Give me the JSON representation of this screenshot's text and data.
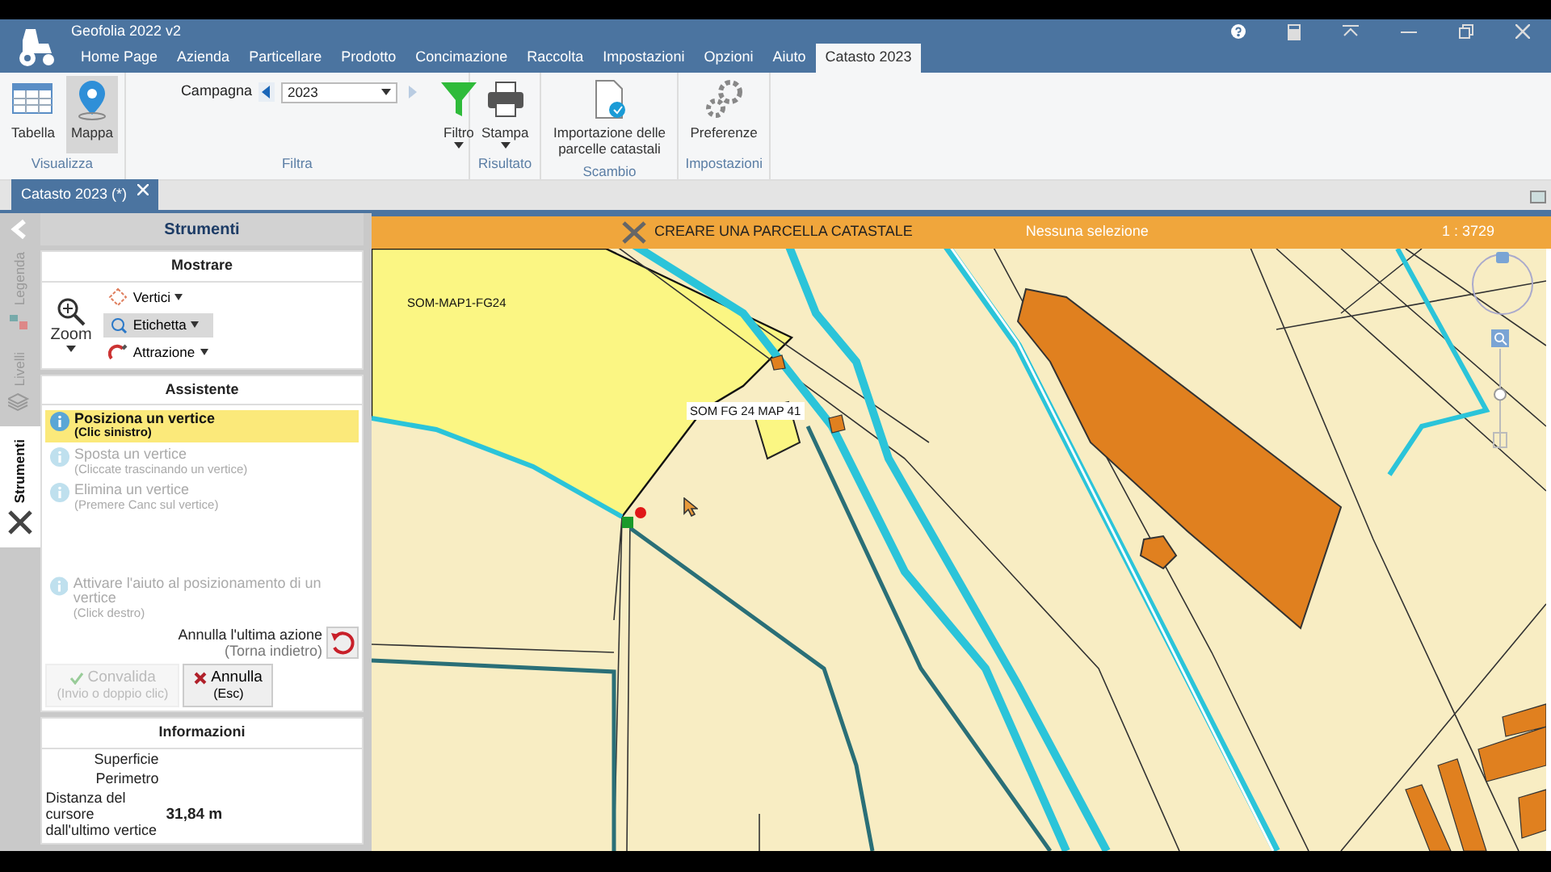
{
  "app": {
    "title": "Geofolia 2022 v2"
  },
  "menu": [
    {
      "label": "Home Page",
      "selected": false
    },
    {
      "label": "Azienda",
      "selected": false
    },
    {
      "label": "Particellare",
      "selected": false
    },
    {
      "label": "Prodotto",
      "selected": false
    },
    {
      "label": "Concimazione",
      "selected": false
    },
    {
      "label": "Raccolta",
      "selected": false
    },
    {
      "label": "Impostazioni",
      "selected": false
    },
    {
      "label": "Opzioni",
      "selected": false
    },
    {
      "label": "Aiuto",
      "selected": false
    },
    {
      "label": "Catasto 2023",
      "selected": true
    }
  ],
  "ribbon": [
    {
      "label": "Visualizza",
      "items": [
        {
          "kind": "toggle",
          "label": "Tabella",
          "selected": false
        },
        {
          "kind": "toggle",
          "label": "Mappa",
          "selected": true
        }
      ]
    },
    {
      "label": "Filtra",
      "items": [
        {
          "kind": "campagna",
          "label": "Campagna",
          "value": "2023"
        },
        {
          "kind": "dropdown",
          "label": "Filtro"
        }
      ]
    },
    {
      "label": "Risultato",
      "items": [
        {
          "kind": "dropdown",
          "label": "Stampa"
        }
      ]
    },
    {
      "label": "Scambio",
      "items": [
        {
          "kind": "menu",
          "label": "Importazione delle parcelle catastali"
        }
      ]
    },
    {
      "label": "Impostazioni",
      "items": [
        {
          "kind": "plain",
          "label": "Preferenze"
        }
      ]
    }
  ],
  "doc_tab": {
    "label": "Catasto 2023 (*)"
  },
  "side_tabs": [
    {
      "label": "Legenda",
      "selected": false
    },
    {
      "label": "Livelli",
      "selected": false
    },
    {
      "label": "Strumenti",
      "selected": true
    }
  ],
  "panel": {
    "title": "Strumenti",
    "mostrare": {
      "title": "Mostrare",
      "zoom": "Zoom",
      "tools": [
        {
          "label": "Vertici",
          "selected": false
        },
        {
          "label": "Etichetta",
          "selected": true
        },
        {
          "label": "Attrazione",
          "selected": false
        }
      ]
    },
    "assistente": {
      "title": "Assistente",
      "steps": [
        {
          "title": "Posiziona un vertice",
          "hint": "(Clic sinistro)",
          "selected": true
        },
        {
          "title": "Sposta un vertice",
          "hint": "(Cliccate trascinando un vertice)",
          "selected": false
        },
        {
          "title": "Elimina un vertice",
          "hint": "(Premere Canc sul vertice)",
          "selected": false
        }
      ],
      "help": {
        "title": "Attivare l'aiuto al posizionamento di un vertice",
        "hint": "(Click destro)",
        "selected": false
      },
      "undo": {
        "label": "Annulla l'ultima azione",
        "hint": "(Torna indietro)"
      },
      "buttons": [
        {
          "kind": "confirm",
          "label": "Convalida",
          "hint": "(Invio o doppio clic)",
          "disabled": true
        },
        {
          "kind": "cancel",
          "label": "Annulla",
          "hint": "(Esc)",
          "disabled": false
        }
      ]
    },
    "informazioni": {
      "title": "Informazioni",
      "rows": [
        {
          "label": "Superficie"
        },
        {
          "label": "Perimetro"
        },
        {
          "label": "Distanza del cursore dall'ultimo vertice",
          "value": "31,84 m"
        }
      ]
    }
  },
  "map": {
    "tool": "CREARE UNA PARCELLA CATASTALE",
    "selection": "Nessuna selezione",
    "scale": "1 : 3729",
    "zoom": {
      "level": 0.55
    },
    "labels": [
      {
        "kind": "plain",
        "text": "SOM-MAP1-FG24"
      },
      {
        "kind": "boxed",
        "text": "SOM FG 24 MAP 41"
      }
    ]
  }
}
